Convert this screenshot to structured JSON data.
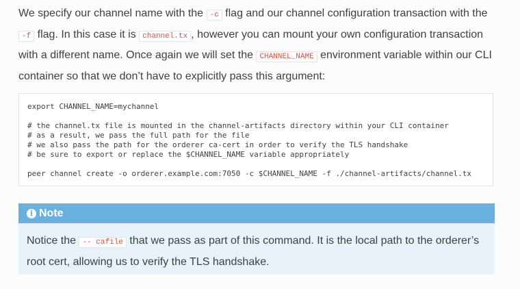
{
  "paragraph": {
    "t1": "We specify our channel name with the ",
    "c1": "-c",
    "t2": " flag and our channel configuration transaction with the ",
    "c2": "-f",
    "t3": " flag. In this case it is ",
    "c3": "channel.tx",
    "t4": ", however you can mount your own configuration transaction with a different name. Once again we will set the ",
    "c4": "CHANNEL_NAME",
    "t5": " environment variable within our CLI container so that we don’t have to explicitly pass this argument:"
  },
  "code_block": {
    "text": "export CHANNEL_NAME=mychannel\n\n# the channel.tx file is mounted in the channel-artifacts directory within your CLI container\n# as a result, we pass the full path for the file\n# we also pass the path for the orderer ca-cert in order to verify the TLS handshake\n# be sure to export or replace the $CHANNEL_NAME variable appropriately\n\npeer channel create -o orderer.example.com:7050 -c $CHANNEL_NAME -f ./channel-artifacts/channel.tx"
  },
  "note": {
    "icon": "info-icon",
    "icon_glyph": "i",
    "title": "Note",
    "t1": "Notice the ",
    "c1": "-- cafile",
    "t2": " that we pass as part of this command. It is the local path to the orderer’s root cert, allowing us to verify the TLS handshake."
  },
  "colors": {
    "text": "#404040",
    "code_accent": "#e74c3c",
    "note_header": "#6ab0de",
    "note_background": "#e7f2fa",
    "page_background": "#fcfcfc"
  }
}
